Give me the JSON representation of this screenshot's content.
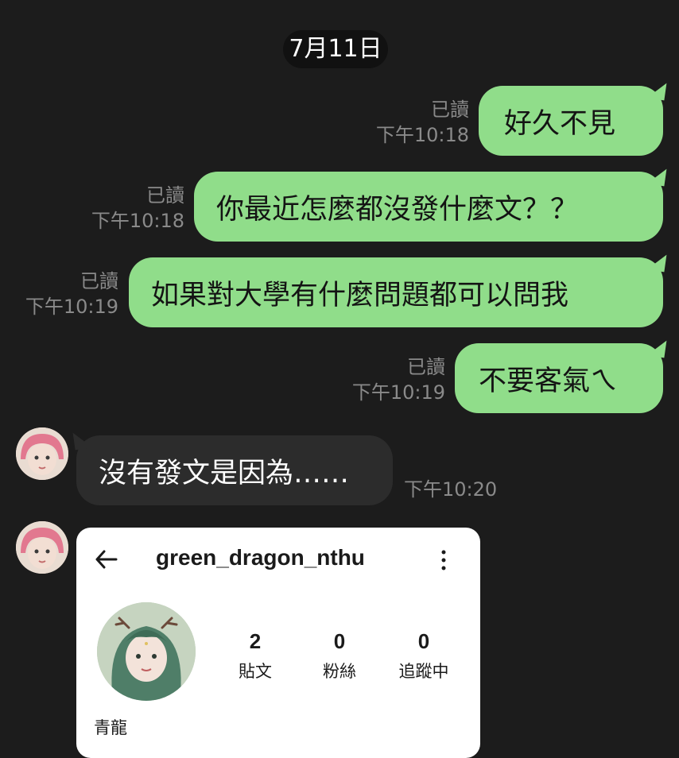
{
  "date": "7月11日",
  "read_label": "已讀",
  "messages_out": [
    {
      "text": "好久不見",
      "time": "下午10:18"
    },
    {
      "text": "你最近怎麼都沒發什麼文？？",
      "time": "下午10:18"
    },
    {
      "text": "如果對大學有什麼問題都可以問我",
      "time": "下午10:19"
    },
    {
      "text": "不要客氣ㄟ",
      "time": "下午10:19"
    }
  ],
  "message_in": {
    "text": "沒有發文是因為……",
    "time": "下午10:20"
  },
  "profile_card": {
    "username": "green_dragon_nthu",
    "display_name": "青龍",
    "stats": [
      {
        "value": "2",
        "label": "貼文"
      },
      {
        "value": "0",
        "label": "粉絲"
      },
      {
        "value": "0",
        "label": "追蹤中"
      }
    ],
    "icons": [
      "back-arrow-icon",
      "more-options-icon"
    ]
  },
  "colors": {
    "background": "#1c1c1c",
    "outgoing_bubble": "#90dd8a",
    "incoming_bubble": "#2c2c2c",
    "meta_text": "#8a8a8a"
  }
}
